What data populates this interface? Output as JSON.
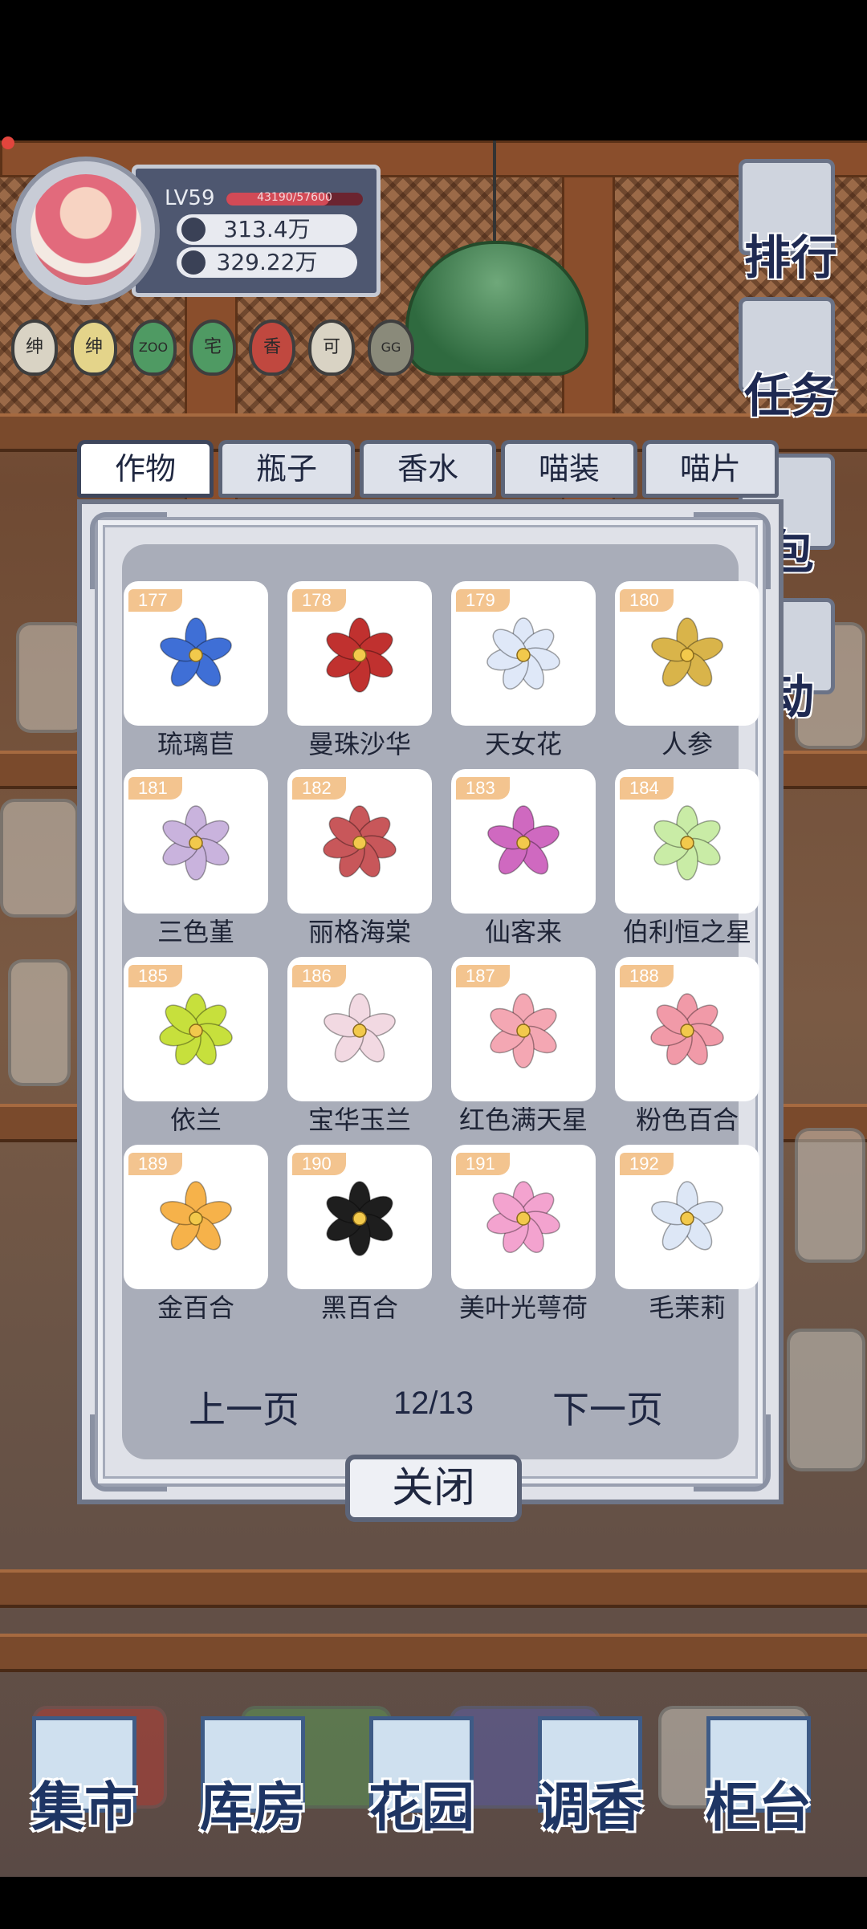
{
  "player": {
    "level": "LV59",
    "xp_text": "43190/57600",
    "xp_fraction": 0.75,
    "stat1": "313.4万",
    "stat2": "329.22万"
  },
  "badges": [
    {
      "text": "绅",
      "color": "#d9d3c4"
    },
    {
      "text": "绅",
      "color": "#e4d48a"
    },
    {
      "text": "ZOO",
      "color": "#4f9a63"
    },
    {
      "text": "宅",
      "color": "#4f9a63"
    },
    {
      "text": "香",
      "color": "#c0483f"
    },
    {
      "text": "可",
      "color": "#d9d3c4"
    },
    {
      "text": "GG",
      "color": "#8a8a7a"
    }
  ],
  "side_menu": {
    "rank": "排行",
    "task": "任务",
    "bag": "包",
    "activity": "动"
  },
  "tabs": [
    "作物",
    "瓶子",
    "香水",
    "喵装",
    "喵片"
  ],
  "active_tab": "作物",
  "items": [
    {
      "num": "177",
      "name": "琉璃苣",
      "color": "#3f6fd6"
    },
    {
      "num": "178",
      "name": "曼珠沙华",
      "color": "#c0312f"
    },
    {
      "num": "179",
      "name": "天女花",
      "color": "#dfe8f8"
    },
    {
      "num": "180",
      "name": "人参",
      "color": "#d9b44a"
    },
    {
      "num": "181",
      "name": "三色堇",
      "color": "#c9b3dd"
    },
    {
      "num": "182",
      "name": "丽格海棠",
      "color": "#c8575a"
    },
    {
      "num": "183",
      "name": "仙客来",
      "color": "#cf69c0"
    },
    {
      "num": "184",
      "name": "伯利恒之星",
      "color": "#c9eca6"
    },
    {
      "num": "185",
      "name": "依兰",
      "color": "#c7e03c"
    },
    {
      "num": "186",
      "name": "宝华玉兰",
      "color": "#f2d9e2"
    },
    {
      "num": "187",
      "name": "红色满天星",
      "color": "#f4a7b3"
    },
    {
      "num": "188",
      "name": "粉色百合",
      "color": "#f19aa8"
    },
    {
      "num": "189",
      "name": "金百合",
      "color": "#f6b24a"
    },
    {
      "num": "190",
      "name": "黑百合",
      "color": "#1e1e1e"
    },
    {
      "num": "191",
      "name": "美叶光萼荷",
      "color": "#f3a3cf"
    },
    {
      "num": "192",
      "name": "毛茉莉",
      "color": "#dde7f6"
    }
  ],
  "pager": {
    "prev": "上一页",
    "count": "12/13",
    "next": "下一页"
  },
  "close_label": "关闭",
  "bottom_nav": [
    "集市",
    "库房",
    "花园",
    "调香",
    "柜台"
  ]
}
